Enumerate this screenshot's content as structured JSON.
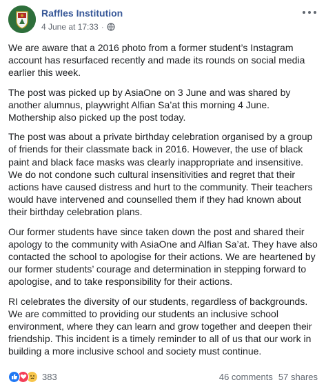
{
  "post": {
    "page_name": "Raffles Institution",
    "timestamp": "4 June at 17:33",
    "separator": "·",
    "paragraphs": [
      "We are aware that a 2016 photo from a former student’s Instagram account has resurfaced recently and made its rounds on social media earlier this week.",
      "The post was picked up by AsiaOne on 3 June and was shared by another alumnus, playwright Alfian Sa’at this morning 4 June. Mothership also picked up the post today.",
      "The post was about a private birthday celebration organised by a group of friends for their classmate back in 2016. However, the use of black paint and black face masks was clearly inappropriate and insensitive. We do not condone such cultural insensitivities and regret that their actions have caused distress and hurt to the community. Their teachers would have intervened and counselled them if they had known about their birthday celebration plans.",
      "Our former students have since taken down the post and shared their apology to the community with AsiaOne and Alfian Sa’at. They have also contacted the school to apologise for their actions. We are heartened by our former students’ courage and determination in stepping forward to apologise, and to take responsibility for their actions.",
      "RI celebrates the diversity of our students, regardless of backgrounds. We are committed to providing our students an inclusive school environment, where they can learn and grow together and deepen their friendship. This incident is a timely reminder to all of us that our work in building a more inclusive school and society must continue."
    ]
  },
  "footer": {
    "reaction_count": "383",
    "comments": "46 comments",
    "shares": "57 shares"
  },
  "icons": {
    "audience": "globe-icon",
    "reactions": [
      "like-icon",
      "love-icon",
      "sad-icon"
    ],
    "menu": "more-options-icon"
  },
  "colors": {
    "page_name": "#385898",
    "like": "#2078f4",
    "love": "#f33e58",
    "sad": "#f7c54b"
  }
}
